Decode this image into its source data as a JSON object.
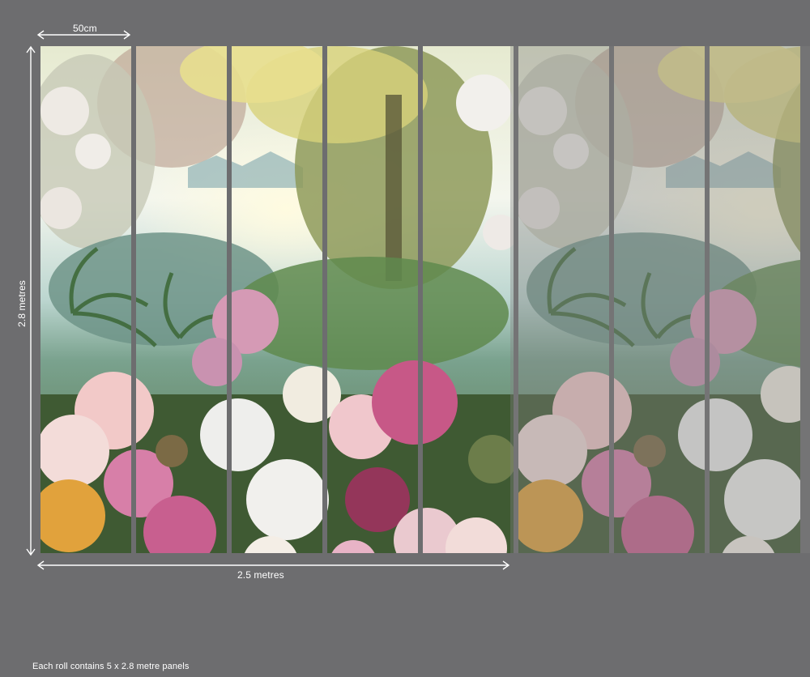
{
  "dimensions": {
    "panel_width": "50cm",
    "height": "2.8 metres",
    "total_width": "2.5 metres"
  },
  "footer_note": "Each roll contains  5 x 2.8 metre panels",
  "panels": {
    "full_color_count": 5,
    "repeat_faded_count": 3
  },
  "colors": {
    "background": "#6d6d6f",
    "annotation": "#ffffff"
  }
}
